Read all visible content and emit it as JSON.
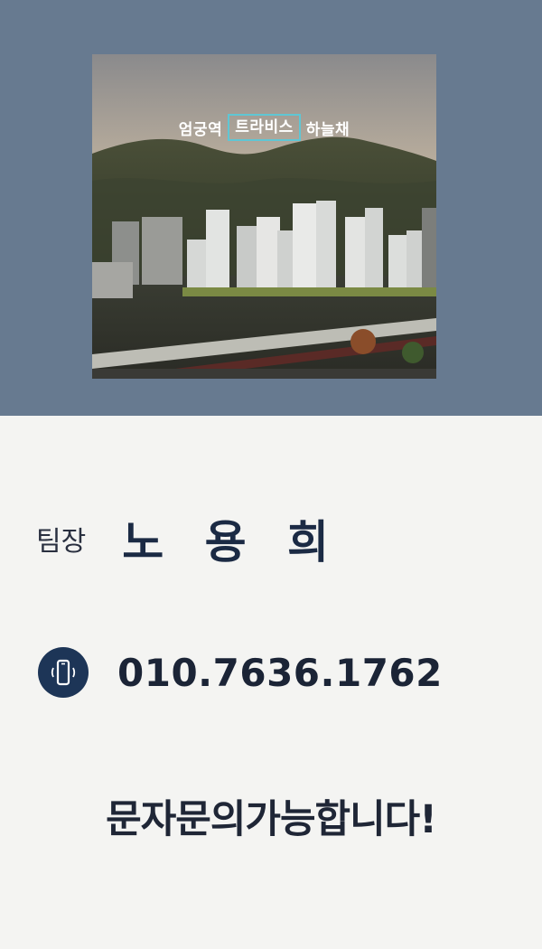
{
  "hero": {
    "brand_left": "엄궁역",
    "brand_mid": "트라비스",
    "brand_right": "하늘채",
    "bg_color": "#677a90",
    "accent_color": "#5fc6d4"
  },
  "contact": {
    "role": "팀장",
    "name": "노 용 희",
    "phone_icon": "mobile-phone-icon",
    "phone": "010.7636.1762",
    "note": "문자문의가능합니다!"
  }
}
